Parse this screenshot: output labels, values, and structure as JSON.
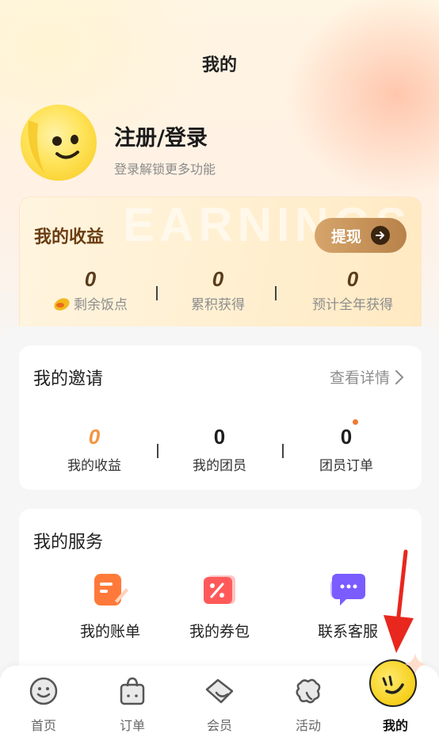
{
  "header": {
    "title": "我的"
  },
  "profile": {
    "login_title": "注册/登录",
    "login_subtitle": "登录解锁更多功能"
  },
  "earnings": {
    "title": "我的收益",
    "watermark": "EARNINGS",
    "withdraw_label": "提现",
    "stats": [
      {
        "value": "0",
        "label": "剩余饭点"
      },
      {
        "value": "0",
        "label": "累积获得"
      },
      {
        "value": "0",
        "label": "预计全年获得"
      }
    ]
  },
  "invitation": {
    "title": "我的邀请",
    "detail_link": "查看详情",
    "stats": [
      {
        "value": "0",
        "label": "我的收益"
      },
      {
        "value": "0",
        "label": "我的团员"
      },
      {
        "value": "0",
        "label": "团员订单"
      }
    ]
  },
  "services": {
    "title": "我的服务",
    "items": [
      {
        "label": "我的账单",
        "icon": "bill-icon"
      },
      {
        "label": "我的券包",
        "icon": "coupon-icon"
      },
      {
        "label": "联系客服",
        "icon": "chat-icon"
      }
    ]
  },
  "tabbar": {
    "items": [
      {
        "label": "首页",
        "icon": "smiley-icon"
      },
      {
        "label": "订单",
        "icon": "bag-icon"
      },
      {
        "label": "会员",
        "icon": "ticket-icon"
      },
      {
        "label": "活动",
        "icon": "cloud-icon"
      },
      {
        "label": "我的",
        "icon": "profile-smiley-icon",
        "active": true
      }
    ]
  },
  "colors": {
    "accent_orange": "#f3953f",
    "earnings_brown": "#6b3d12",
    "withdraw_gold": "#c9955a",
    "arrow_red": "#e8271e"
  }
}
